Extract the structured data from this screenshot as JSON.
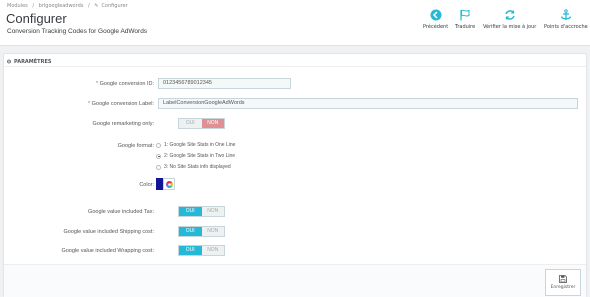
{
  "breadcrumb": {
    "items": [
      "Modules",
      "/",
      "brlgoogleadwords",
      "/",
      "Configurer"
    ]
  },
  "header": {
    "title": "Configurer",
    "subtitle": "Conversion Tracking Codes for Google AdWords"
  },
  "toolbar": {
    "prev_label": "Précédent",
    "translate_label": "Traduire",
    "update_label": "Vérifier la mise à jour",
    "hooks_label": "Points d'accroche"
  },
  "panel": {
    "heading": "PARAMÈTRES"
  },
  "form": {
    "conversion_id_label": "Google conversion ID:",
    "conversion_id_value": "0123456789012345",
    "conversion_label_label": "Google conversion Label:",
    "conversion_label_value": "LabelConversionGoogleAdWords",
    "remarketing_label": "Google remarketing only:",
    "format_label": "Google format:",
    "format_options": [
      "1: Google Site Stats in One Line",
      "2: Google Site Stats in Two Line",
      "3: No Site Stats info displayed"
    ],
    "format_selected": 2,
    "color_label": "Color:",
    "color_value": "#141496",
    "tax_label": "Google value included Tax:",
    "shipping_label": "Google value included Shipping cost:",
    "wrapping_label": "Google value included Wrapping cost:",
    "yes": "OUI",
    "no": "NON"
  },
  "footer": {
    "save_label": "Enregistrer"
  },
  "colors": {
    "accent": "#25b9d7",
    "danger_toggle": "#e08f95",
    "required": "#c05c67"
  }
}
